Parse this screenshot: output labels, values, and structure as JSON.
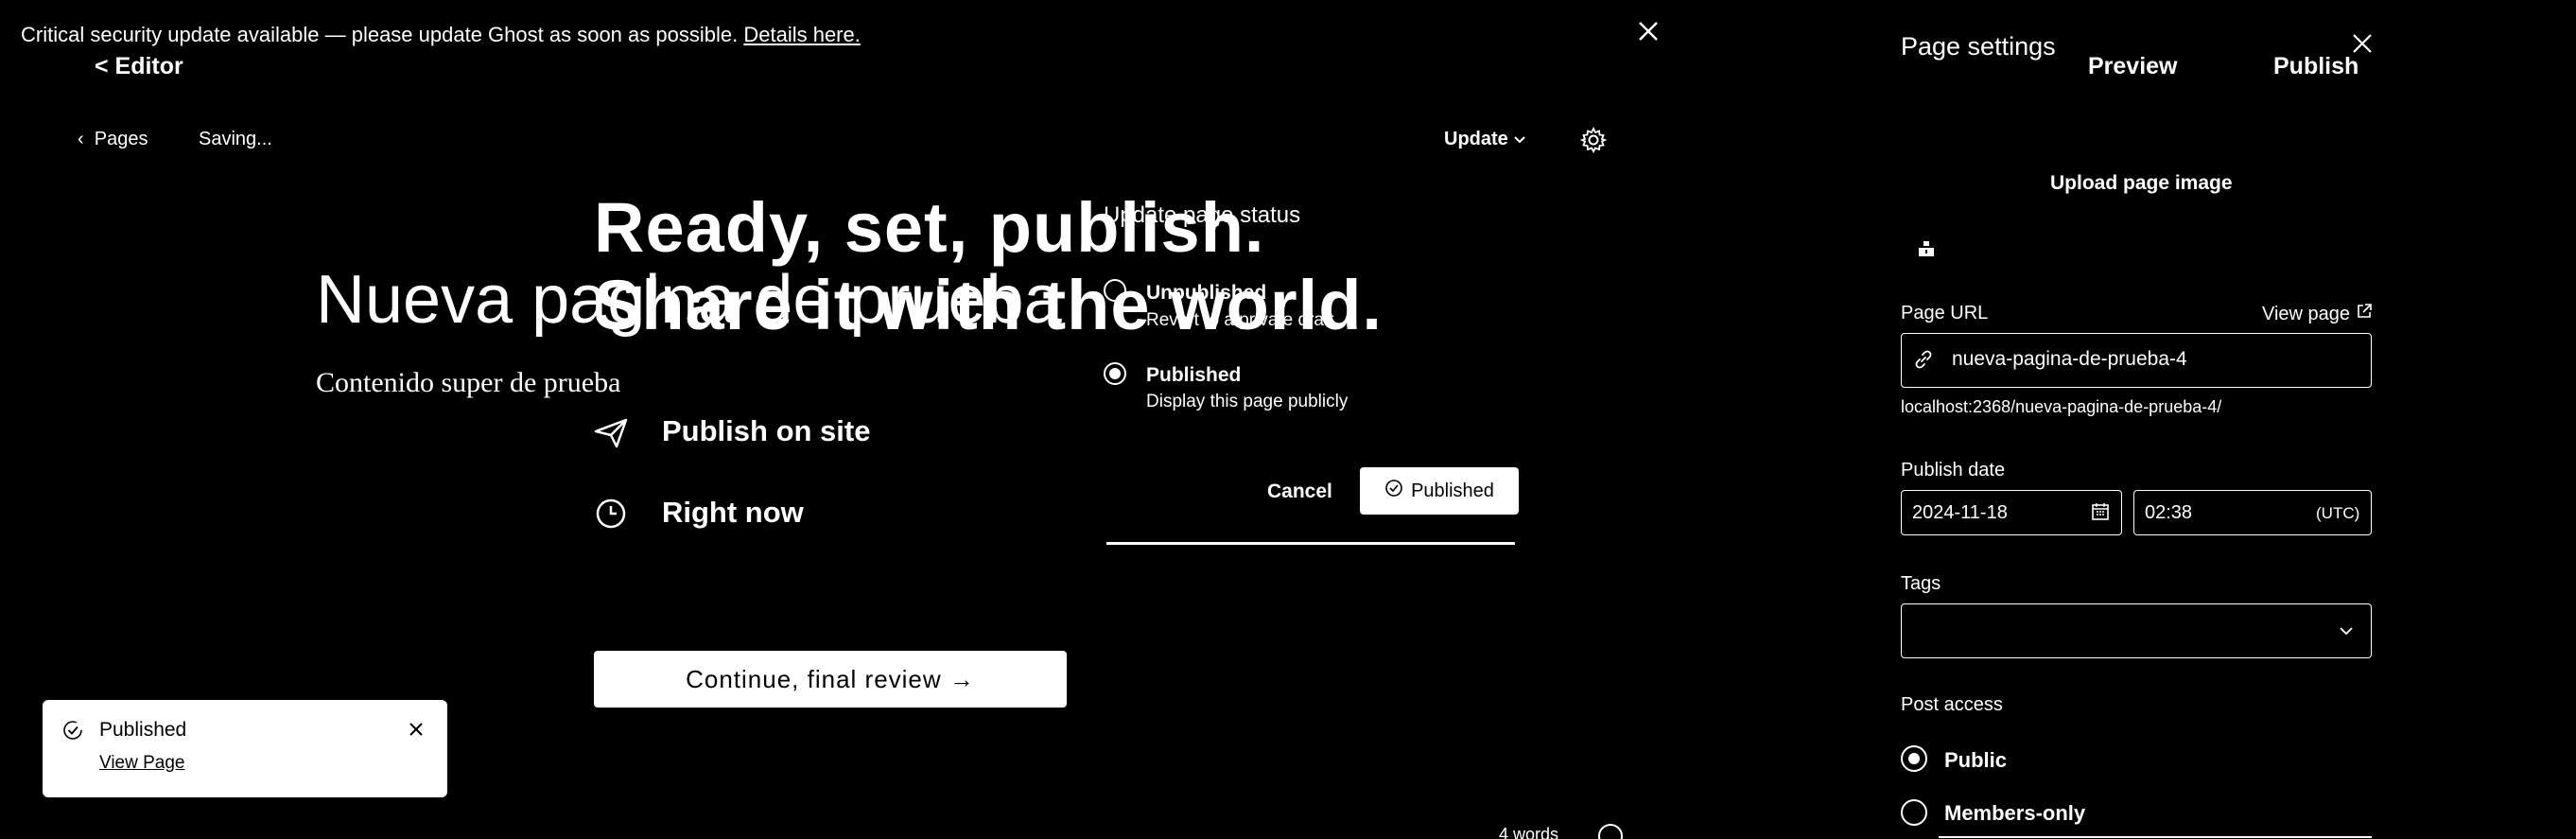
{
  "banner": {
    "text": "Critical security update available — please update Ghost as soon as possible.",
    "link": "Details here."
  },
  "publish_bar": {
    "back_label": "< Editor",
    "preview_label": "Preview",
    "publish_label": "Publish"
  },
  "editor": {
    "pages_link": "Pages",
    "status": "Saving...",
    "update_label": "Update",
    "title": "Nueva pagina de prueba",
    "body": "Contenido super de prueba",
    "word_count": "4 words"
  },
  "publish_modal": {
    "heading_1": "Ready, set, publish.",
    "heading_2": "Share it with the world.",
    "row_1": "Publish on site",
    "row_2": "Right now",
    "continue_label": "Continue, final review →"
  },
  "status_popup": {
    "title": "Update page status",
    "options": [
      {
        "label": "Unpublished",
        "desc": "Revert to a private draft",
        "selected": false
      },
      {
        "label": "Published",
        "desc": "Display this page publicly",
        "selected": true
      }
    ],
    "cancel_label": "Cancel",
    "confirm_label": "Published"
  },
  "toast": {
    "title": "Published",
    "link": "View Page"
  },
  "settings": {
    "title": "Page settings",
    "upload_label": "Upload page image",
    "url_label": "Page URL",
    "view_page_label": "View page",
    "url_value": "nueva-pagina-de-prueba-4",
    "url_hint": "localhost:2368/nueva-pagina-de-prueba-4/",
    "date_label": "Publish date",
    "date_value": "2024-11-18",
    "time_value": "02:38",
    "timezone": "(UTC)",
    "tags_label": "Tags",
    "access_label": "Post access",
    "access_options": [
      {
        "label": "Public",
        "selected": true
      },
      {
        "label": "Members-only",
        "selected": false
      }
    ]
  },
  "colors": {
    "background": "#000000",
    "foreground": "#ffffff"
  },
  "icons": {
    "banner_close": "close-icon",
    "gear": "gear-icon",
    "send": "send-icon",
    "clock": "clock-icon",
    "check": "check-circle-icon",
    "link": "link-icon",
    "external": "external-link-icon",
    "calendar": "calendar-icon",
    "chevron": "chevron-down-icon",
    "help": "help-icon"
  }
}
